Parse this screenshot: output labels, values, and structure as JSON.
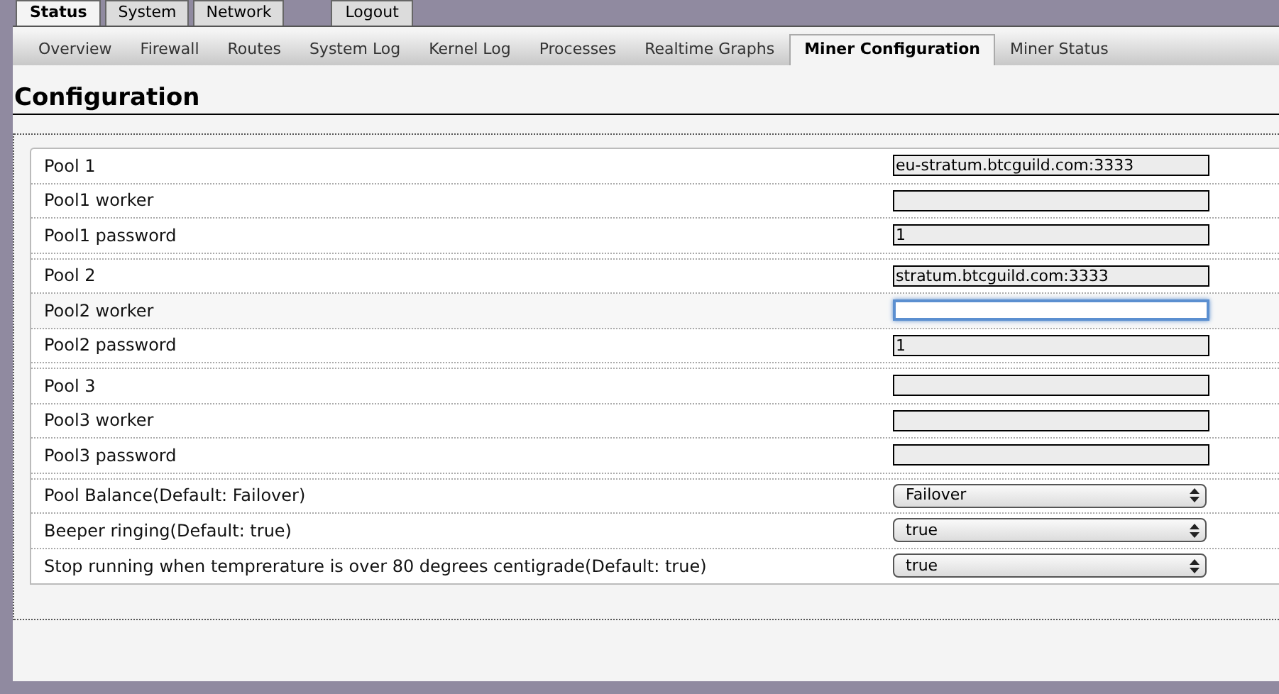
{
  "top_tabs": [
    {
      "label": "Status",
      "selected": true
    },
    {
      "label": "System",
      "selected": false
    },
    {
      "label": "Network",
      "selected": false
    },
    {
      "label": "Logout",
      "selected": false
    }
  ],
  "sub_tabs": [
    {
      "label": "Overview",
      "selected": false
    },
    {
      "label": "Firewall",
      "selected": false
    },
    {
      "label": "Routes",
      "selected": false
    },
    {
      "label": "System Log",
      "selected": false
    },
    {
      "label": "Kernel Log",
      "selected": false
    },
    {
      "label": "Processes",
      "selected": false
    },
    {
      "label": "Realtime Graphs",
      "selected": false
    },
    {
      "label": "Miner Configuration",
      "selected": true
    },
    {
      "label": "Miner Status",
      "selected": false
    }
  ],
  "heading": "Configuration",
  "sections": [
    {
      "rows": [
        {
          "kind": "text",
          "label": "Pool 1",
          "value": "eu-stratum.btcguild.com:3333",
          "focused": false
        },
        {
          "kind": "text",
          "label": "Pool1 worker",
          "focused": false
        },
        {
          "kind": "text",
          "label": "Pool1 password",
          "value": "1",
          "focused": false
        }
      ]
    },
    {
      "rows": [
        {
          "kind": "text",
          "label": "Pool 2",
          "value": "stratum.btcguild.com:3333",
          "focused": false
        },
        {
          "kind": "text",
          "label": "Pool2 worker",
          "focused": true
        },
        {
          "kind": "text",
          "label": "Pool2 password",
          "value": "1",
          "focused": false
        }
      ]
    },
    {
      "rows": [
        {
          "kind": "text",
          "label": "Pool 3",
          "focused": false
        },
        {
          "kind": "text",
          "label": "Pool3 worker",
          "focused": false
        },
        {
          "kind": "text",
          "label": "Pool3 password",
          "focused": false
        }
      ]
    },
    {
      "rows": [
        {
          "kind": "select",
          "label": "Pool Balance(Default: Failover)",
          "value": "Failover"
        },
        {
          "kind": "select",
          "label": "Beeper ringing(Default: true)",
          "value": "true"
        },
        {
          "kind": "select",
          "label": "Stop running when temprerature is over 80 degrees centigrade(Default: true)",
          "value": "true"
        }
      ]
    }
  ]
}
